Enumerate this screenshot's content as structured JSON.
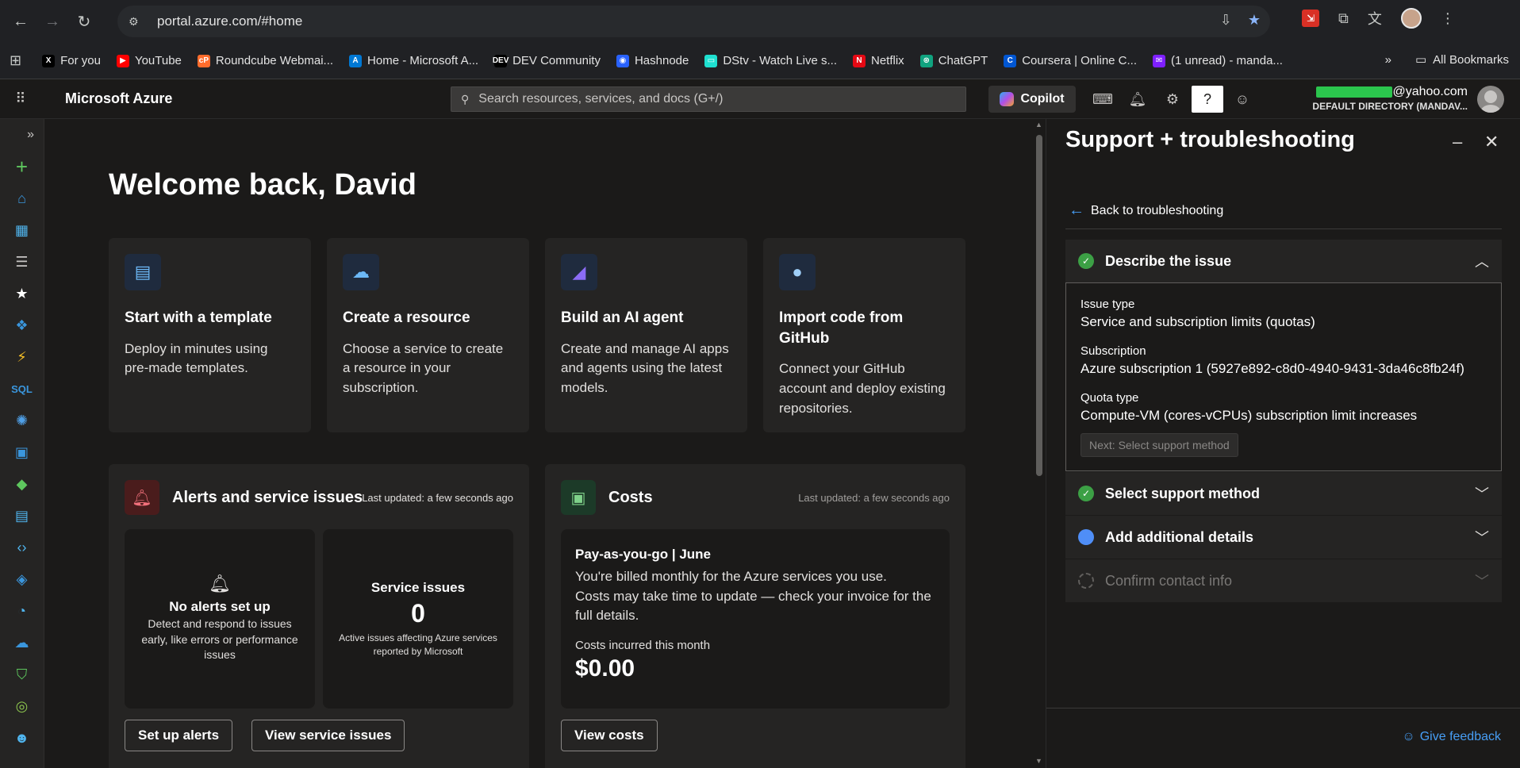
{
  "browser": {
    "url": "portal.azure.com/#home",
    "bookmarks": [
      {
        "label": "For you",
        "icon": "x-icon",
        "color": "#000000",
        "glyph": "X"
      },
      {
        "label": "YouTube",
        "icon": "youtube-icon",
        "color": "#ff0000",
        "glyph": "▶"
      },
      {
        "label": "Roundcube Webmai...",
        "icon": "cpanel-icon",
        "color": "#ff6c2c",
        "glyph": "cP"
      },
      {
        "label": "Home - Microsoft A...",
        "icon": "azure-icon",
        "color": "#0078d4",
        "glyph": "A"
      },
      {
        "label": "DEV Community",
        "icon": "dev-icon",
        "color": "#000000",
        "glyph": "DEV"
      },
      {
        "label": "Hashnode",
        "icon": "hashnode-icon",
        "color": "#2962ff",
        "glyph": "◉"
      },
      {
        "label": "DStv - Watch Live s...",
        "icon": "dstv-icon",
        "color": "#1ee0d0",
        "glyph": "▭"
      },
      {
        "label": "Netflix",
        "icon": "netflix-icon",
        "color": "#e50914",
        "glyph": "N"
      },
      {
        "label": "ChatGPT",
        "icon": "chatgpt-icon",
        "color": "#10a37f",
        "glyph": "⊛"
      },
      {
        "label": "Coursera | Online C...",
        "icon": "coursera-icon",
        "color": "#0056d2",
        "glyph": "C"
      },
      {
        "label": "(1 unread) - manda...",
        "icon": "yahoo-mail-icon",
        "color": "#7e1fff",
        "glyph": "✉"
      }
    ],
    "more_label": "»",
    "all_bookmarks": "All Bookmarks"
  },
  "azure_header": {
    "title": "Microsoft Azure",
    "search_placeholder": "Search resources, services, and docs (G+/)",
    "copilot": "Copilot",
    "email_suffix": "@yahoo.com",
    "directory": "DEFAULT DIRECTORY (MANDAV..."
  },
  "welcome": "Welcome back, David",
  "cards": [
    {
      "title": "Start with a template",
      "desc": "Deploy in minutes using pre-made templates.",
      "icon": "template-icon"
    },
    {
      "title": "Create a resource",
      "desc": "Choose a service to create a resource in your subscription.",
      "icon": "cloud-resource-icon"
    },
    {
      "title": "Build an AI agent",
      "desc": "Create and manage AI apps and agents using the latest models.",
      "icon": "ai-foundry-icon"
    },
    {
      "title": "Import code from GitHub",
      "desc": "Connect your GitHub account and deploy existing repositories.",
      "icon": "github-icon"
    }
  ],
  "alerts_panel": {
    "title": "Alerts and service issues",
    "updated": "Last updated: a few seconds ago",
    "no_alerts_title": "No alerts set up",
    "no_alerts_desc": "Detect and respond to issues early, like errors or performance issues",
    "service_issues_title": "Service issues",
    "service_issues_count": "0",
    "service_issues_desc": "Active issues affecting Azure services reported by Microsoft",
    "btn_setup": "Set up alerts",
    "btn_view": "View service issues"
  },
  "costs_panel": {
    "title": "Costs",
    "updated": "Last updated: a few seconds ago",
    "plan": "Pay-as-you-go | June",
    "line1": "You're billed monthly for the Azure services you use.",
    "line2": "Costs may take time to update — check your invoice for the full details.",
    "incurred_label": "Costs incurred this month",
    "amount": "$0.00",
    "btn": "View costs"
  },
  "side_panel": {
    "title": "Support + troubleshooting",
    "back": "Back to troubleshooting",
    "steps": [
      {
        "label": "Describe the issue",
        "status": "done"
      },
      {
        "label": "Select support method",
        "status": "done"
      },
      {
        "label": "Add additional details",
        "status": "current"
      },
      {
        "label": "Confirm contact info",
        "status": "pending"
      }
    ],
    "issue_type_label": "Issue type",
    "issue_type_value": "Service and subscription limits (quotas)",
    "subscription_label": "Subscription",
    "subscription_value": "Azure subscription 1 (5927e892-c8d0-4940-9431-3da46c8fb24f)",
    "quota_label": "Quota type",
    "quota_value": "Compute-VM (cores-vCPUs) subscription limit increases",
    "next_btn": "Next: Select support method",
    "feedback": "Give feedback"
  }
}
